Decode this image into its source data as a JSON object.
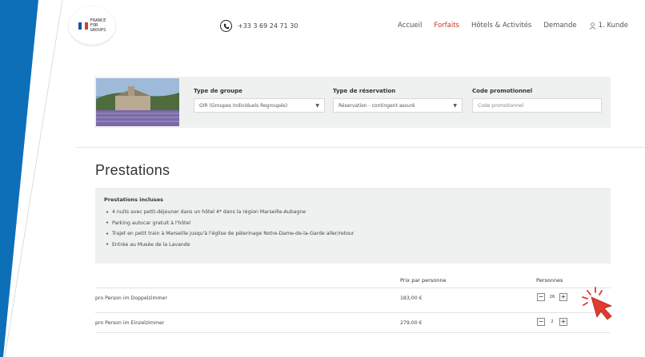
{
  "colors": {
    "accent": "#c0392b",
    "brand_blue": "#0d6fb8",
    "panel_bg": "#eff0f0"
  },
  "header": {
    "logo": {
      "text": "FRANCE\nFOR\nGROUPS"
    },
    "phone": {
      "icon": "phone-icon",
      "number": "+33 3 69 24 71 30"
    },
    "nav": [
      {
        "label": "Accueil",
        "active": false
      },
      {
        "label": "Forfaits",
        "active": true
      },
      {
        "label": "Hôtels & Activités",
        "active": false
      },
      {
        "label": "Demande",
        "active": false
      }
    ],
    "user": {
      "icon": "user-icon",
      "label": "1. Kunde"
    }
  },
  "filters": {
    "group_type": {
      "label": "Type de groupe",
      "value": "GIR (Groupes Individuels Regroupés)"
    },
    "reservation_type": {
      "label": "Type de réservation",
      "value": "Réservation - contingent assuré"
    },
    "promo": {
      "label": "Code promotionnel",
      "placeholder": "Code promotionnel"
    }
  },
  "prestations": {
    "title": "Prestations",
    "included_title": "Prestations incluses",
    "included_items": [
      "4 nuits avec petit-déjeuner dans un hôtel 4* dans la région Marseille-Aubagne",
      "Parking autocar gratuit à l'hôtel",
      "Trajet en petit train à Marseille jusqu'à l'église de pèlerinage Notre-Dame-de-la-Garde aller/retour",
      "Entrée au Musée de la Lavande"
    ]
  },
  "pricing_table": {
    "headers": {
      "price": "Prix par personne",
      "persons": "Personnes"
    },
    "rows": [
      {
        "label": "pro Person im Doppelzimmer",
        "price": "183,00 €",
        "persons": "26"
      },
      {
        "label": "pro Person im Einzelzimmer",
        "price": "279,00 €",
        "persons": "2"
      }
    ]
  }
}
